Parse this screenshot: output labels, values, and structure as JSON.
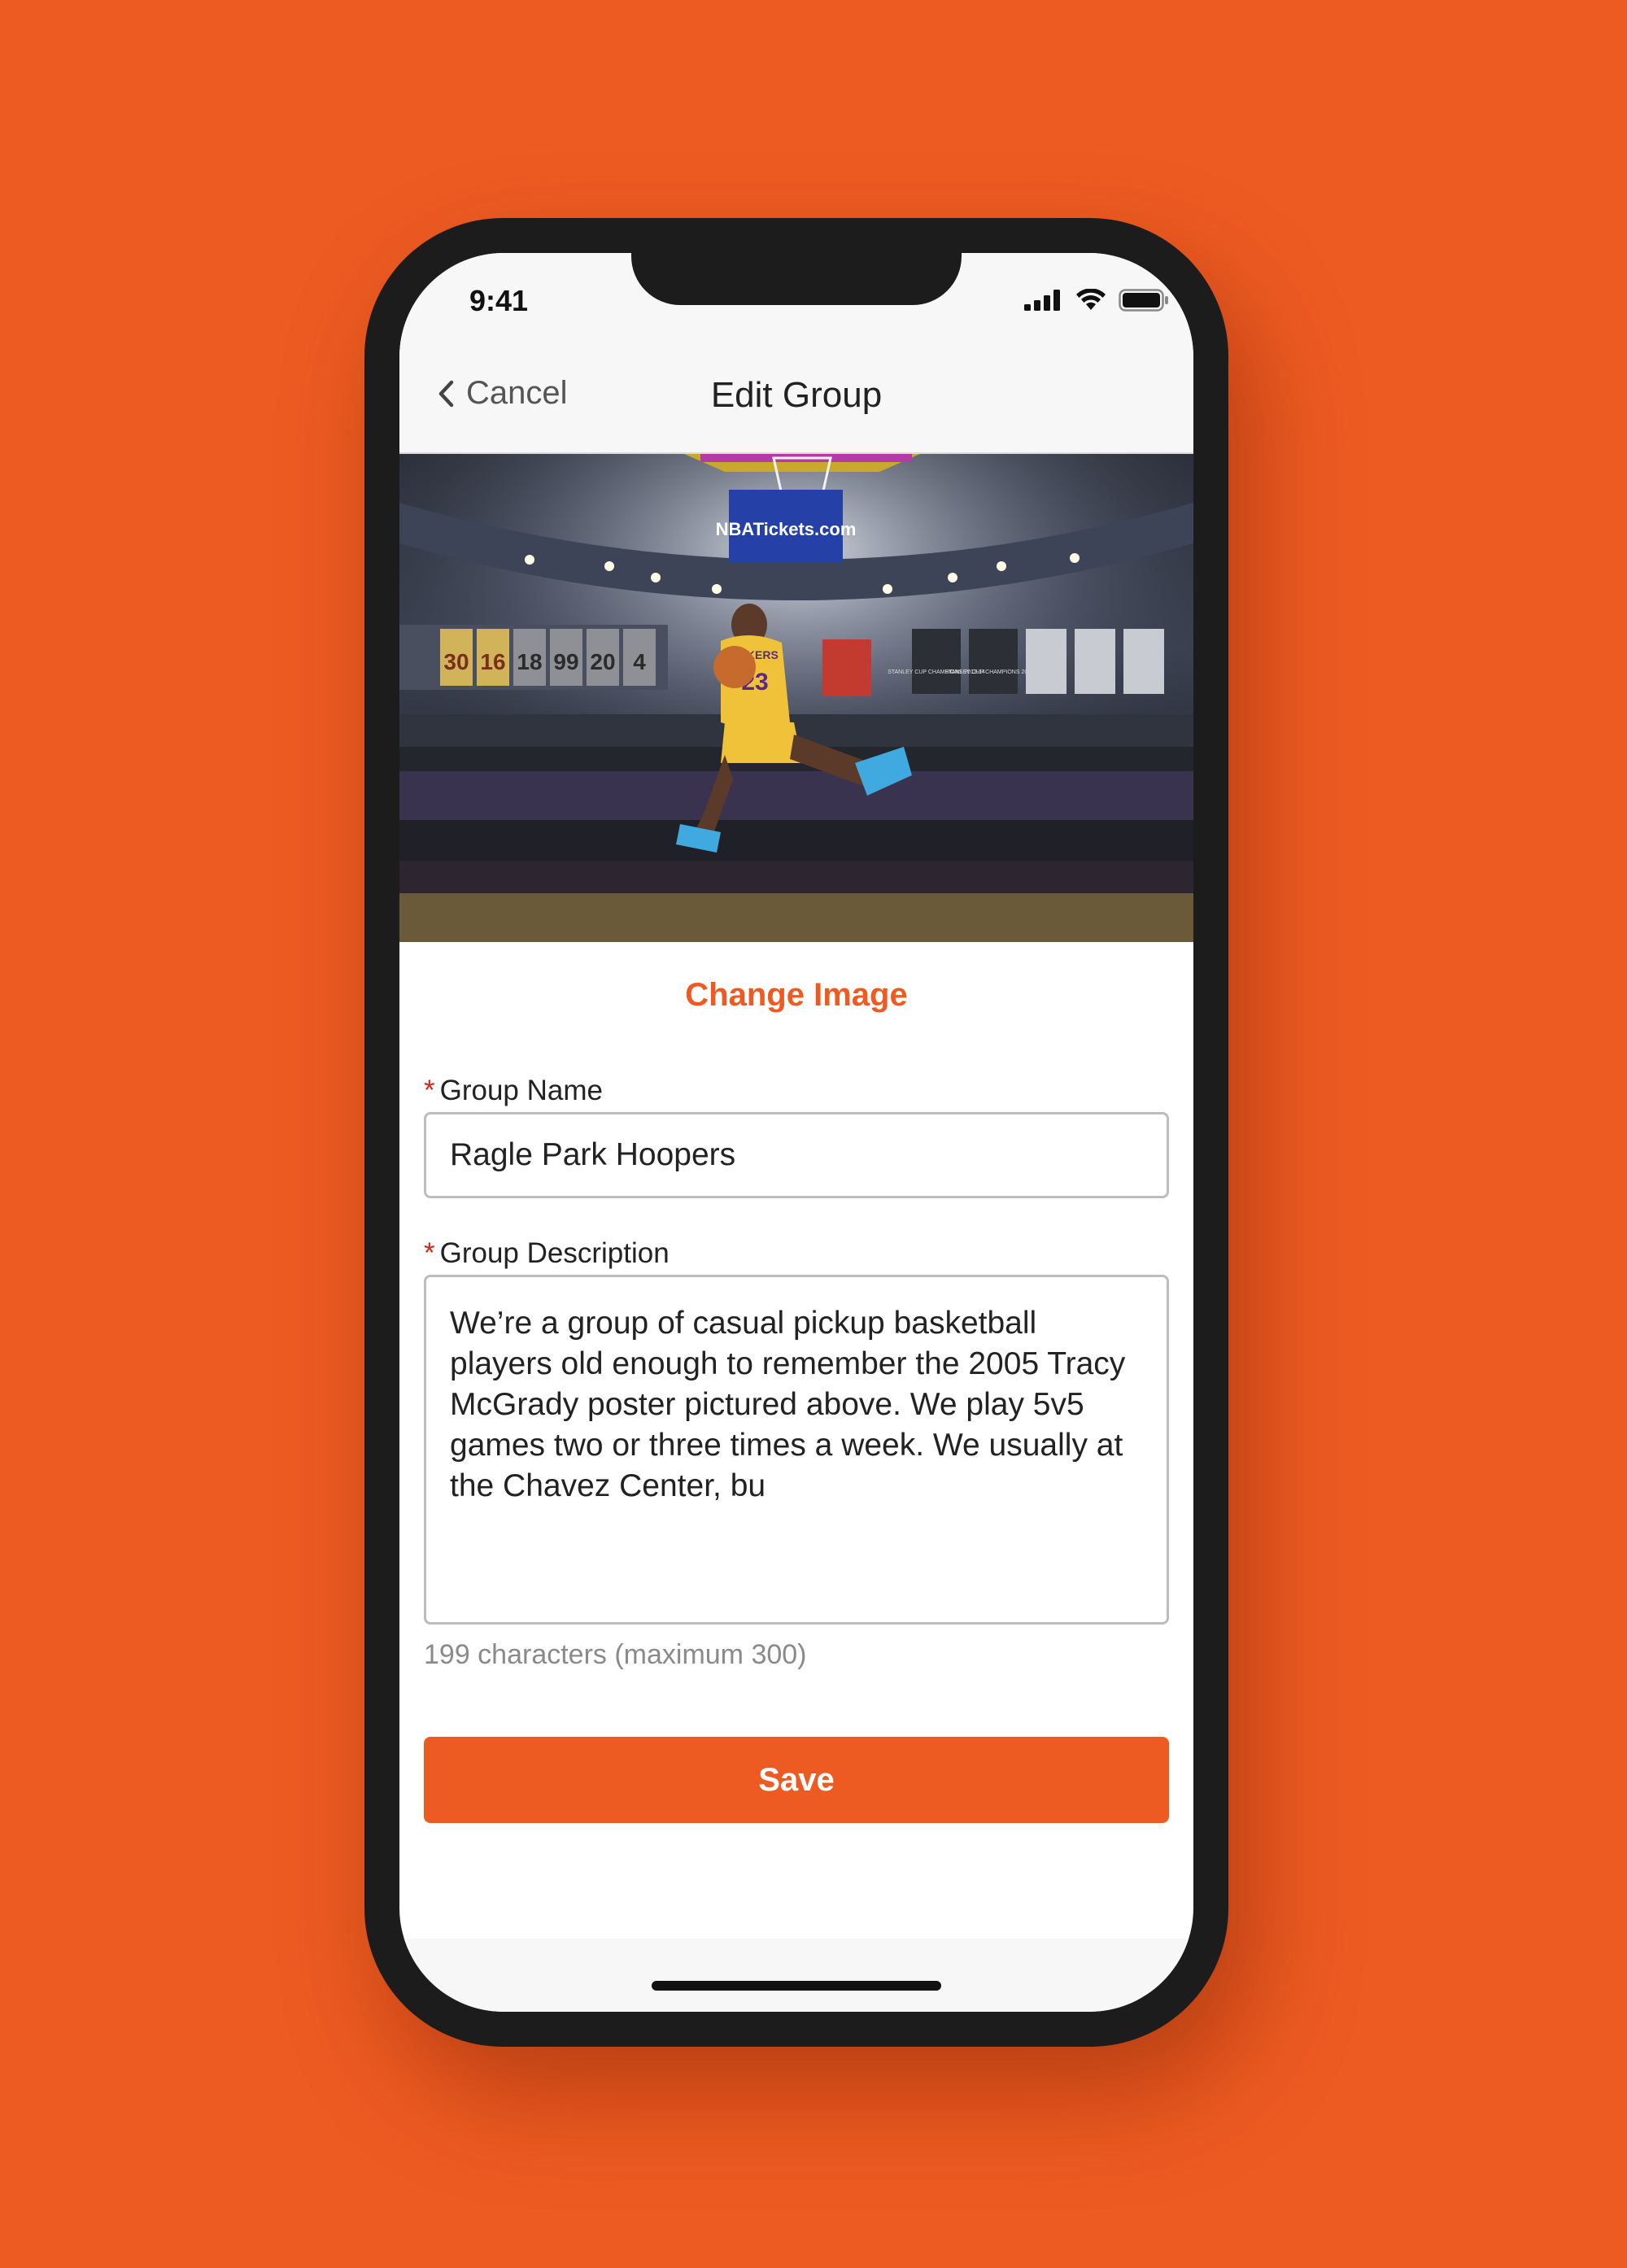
{
  "status_bar": {
    "time": "9:41",
    "icons": [
      "signal-icon",
      "wifi-icon",
      "battery-icon"
    ]
  },
  "nav": {
    "back_icon": "chevron-left-icon",
    "cancel_label": "Cancel",
    "title": "Edit Group"
  },
  "hero_image": {
    "banner_text": "NBATickets.com",
    "jersey_text": "LAKERS",
    "jersey_number": "23",
    "retired_numbers": [
      "30",
      "16",
      "18",
      "99",
      "20",
      "4"
    ],
    "championship_banners": [
      "STANLEY CUP CHAMPIONS 2013-14",
      "STANLEY CUP CHAMPIONS 2011-12"
    ]
  },
  "form": {
    "change_image_label": "Change Image",
    "required_marker": "*",
    "group_name_label": "Group Name",
    "group_name_value": "Ragle Park Hoopers",
    "group_description_label": "Group Description",
    "group_description_value": "We’re a group of casual pickup basketball players old enough to remember the 2005 Tracy McGrady poster pictured above. We play 5v5 games two or three times a week. We usually at the Chavez Center, bu",
    "char_count": "199 characters (maximum 300)",
    "save_label": "Save"
  },
  "colors": {
    "background": "#EE5B22",
    "accent": "#EE5B22",
    "required": "#d0261b",
    "phone_frame": "#1c1c1c"
  }
}
